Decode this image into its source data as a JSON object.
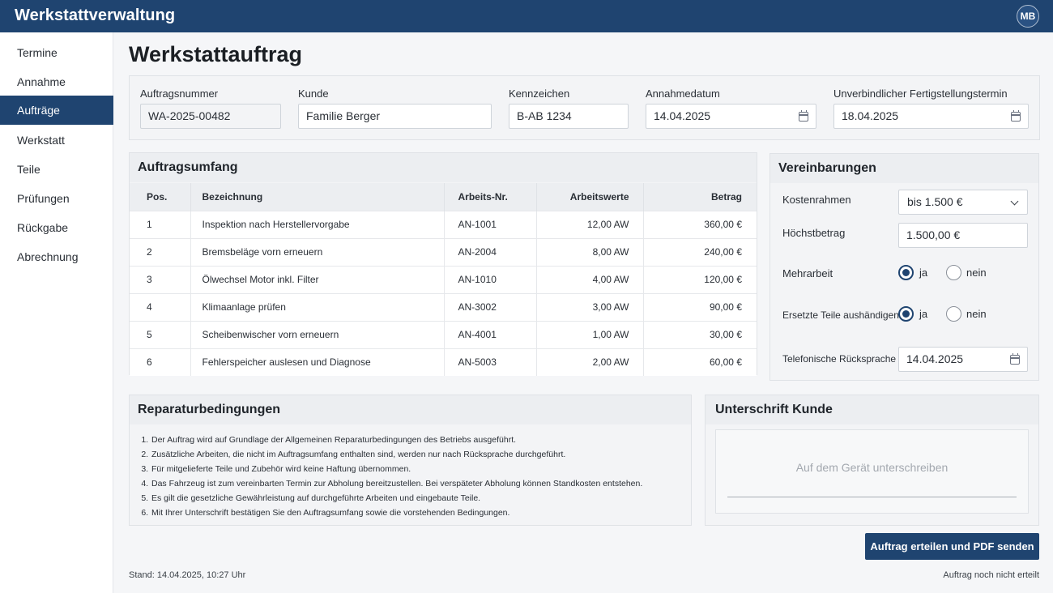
{
  "app": {
    "title": "Werkstattverwaltung",
    "user_initials": "MB"
  },
  "sidebar": {
    "items": [
      {
        "label": "Termine",
        "active": false
      },
      {
        "label": "Annahme",
        "active": false
      },
      {
        "label": "Aufträge",
        "active": true
      },
      {
        "label": "Werkstatt",
        "active": false
      },
      {
        "label": "Teile",
        "active": false
      },
      {
        "label": "Prüfungen",
        "active": false
      },
      {
        "label": "Rückgabe",
        "active": false
      },
      {
        "label": "Abrechnung",
        "active": false
      }
    ]
  },
  "page": {
    "title": "Werkstattauftrag"
  },
  "header_fields": {
    "order_number": {
      "label": "Auftragsnummer",
      "value": "WA-2025-00482"
    },
    "customer": {
      "label": "Kunde",
      "value": "Familie Berger"
    },
    "plate": {
      "label": "Kennzeichen",
      "value": "B-AB 1234"
    },
    "intake_date": {
      "label": "Annahmedatum",
      "value": "14.04.2025"
    },
    "completion_date": {
      "label": "Unverbindlicher Fertigstellungstermin",
      "value": "18.04.2025"
    }
  },
  "scope": {
    "title": "Auftragsumfang",
    "columns": [
      "Pos.",
      "Bezeichnung",
      "Arbeits-Nr.",
      "Arbeitswerte",
      "Betrag"
    ],
    "rows": [
      {
        "pos": "1",
        "desc": "Inspektion nach Herstellervorgabe",
        "nr": "AN-1001",
        "aw": "12,00 AW",
        "amount": "360,00 €"
      },
      {
        "pos": "2",
        "desc": "Bremsbeläge vorn erneuern",
        "nr": "AN-2004",
        "aw": "8,00 AW",
        "amount": "240,00 €"
      },
      {
        "pos": "3",
        "desc": "Ölwechsel Motor inkl. Filter",
        "nr": "AN-1010",
        "aw": "4,00 AW",
        "amount": "120,00 €"
      },
      {
        "pos": "4",
        "desc": "Klimaanlage prüfen",
        "nr": "AN-3002",
        "aw": "3,00 AW",
        "amount": "90,00 €"
      },
      {
        "pos": "5",
        "desc": "Scheibenwischer vorn erneuern",
        "nr": "AN-4001",
        "aw": "1,00 AW",
        "amount": "30,00 €"
      },
      {
        "pos": "6",
        "desc": "Fehlerspeicher auslesen und Diagnose",
        "nr": "AN-5003",
        "aw": "2,00 AW",
        "amount": "60,00 €"
      }
    ]
  },
  "agreements": {
    "title": "Vereinbarungen",
    "cost_frame": {
      "label": "Kostenrahmen",
      "value": "bis 1.500 €"
    },
    "max_amount": {
      "label": "Höchstbetrag",
      "value": "1.500,00 €"
    },
    "extra_work": {
      "label": "Mehrarbeit",
      "yes": "ja",
      "no": "nein",
      "selected": "ja"
    },
    "return_parts": {
      "label": "Ersetzte Teile aushändigen",
      "yes": "ja",
      "no": "nein",
      "selected": "ja"
    },
    "phone_callback": {
      "label": "Telefonische Rücksprache",
      "value": "14.04.2025"
    }
  },
  "conditions": {
    "title": "Reparaturbedingungen",
    "items": [
      "Der Auftrag wird auf Grundlage der Allgemeinen Reparaturbedingungen des Betriebs ausgeführt.",
      "Zusätzliche Arbeiten, die nicht im Auftragsumfang enthalten sind, werden nur nach Rücksprache durchgeführt.",
      "Für mitgelieferte Teile und Zubehör wird keine Haftung übernommen.",
      "Das Fahrzeug ist zum vereinbarten Termin zur Abholung bereitzustellen. Bei verspäteter Abholung können Standkosten entstehen.",
      "Es gilt die gesetzliche Gewährleistung auf durchgeführte Arbeiten und eingebaute Teile.",
      "Mit Ihrer Unterschrift bestätigen Sie den Auftragsumfang sowie die vorstehenden Bedingungen."
    ]
  },
  "signature": {
    "title": "Unterschrift Kunde",
    "hint": "Auf dem Gerät unterschreiben"
  },
  "actions": {
    "submit_label": "Auftrag erteilen und PDF senden"
  },
  "footer": {
    "status_time": "Stand: 14.04.2025, 10:27 Uhr",
    "order_state": "Auftrag noch nicht erteilt"
  },
  "colors": {
    "primary": "#1f4470"
  }
}
